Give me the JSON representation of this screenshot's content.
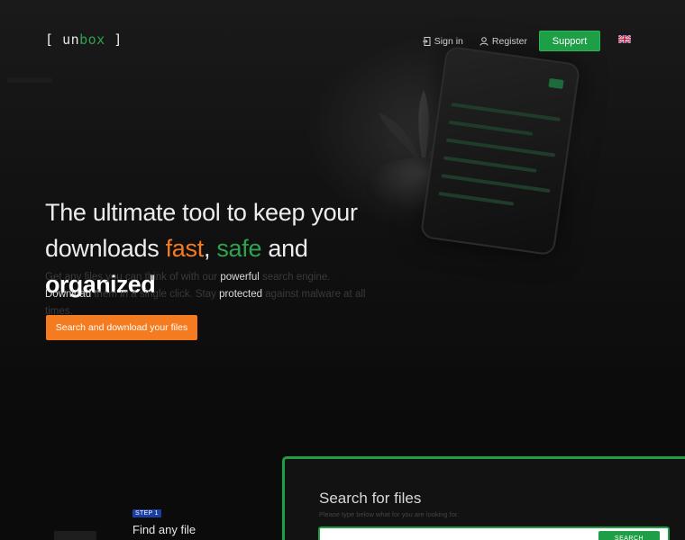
{
  "header": {
    "logo_open": "[",
    "logo_un": "un",
    "logo_box": "box",
    "logo_close": "]",
    "nav": {
      "signin_label": "Sign in",
      "register_label": "Register",
      "support_label": "Support"
    },
    "language_flag_icon": "uk-flag-icon"
  },
  "hero": {
    "headline_part1": "The ultimate tool to keep your downloads",
    "headline_fast": "fast",
    "headline_comma": ",",
    "headline_safe": "safe",
    "headline_and": "and",
    "headline_organized": "organized",
    "sub_1": "Get any files you can think of with our",
    "sub_powerful": "powerful",
    "sub_2": "search engine.",
    "sub_download": "Download",
    "sub_3": "them in a single click. Stay",
    "sub_protected": "protected",
    "sub_4": "against malware at all times.",
    "cta_label": "Search and download your files"
  },
  "steps": {
    "step_tag": "STEP 1",
    "step_title": "Find any file"
  },
  "search": {
    "title": "Search for files",
    "subtitle": "Please type below what for you are looking for.",
    "input_placeholder": "",
    "button_label": "SEARCH"
  },
  "colors": {
    "brand_green": "#1e9e46",
    "accent_orange": "#f47b20",
    "step_blue": "#1b3fa0",
    "background": "#0b0b0b"
  }
}
